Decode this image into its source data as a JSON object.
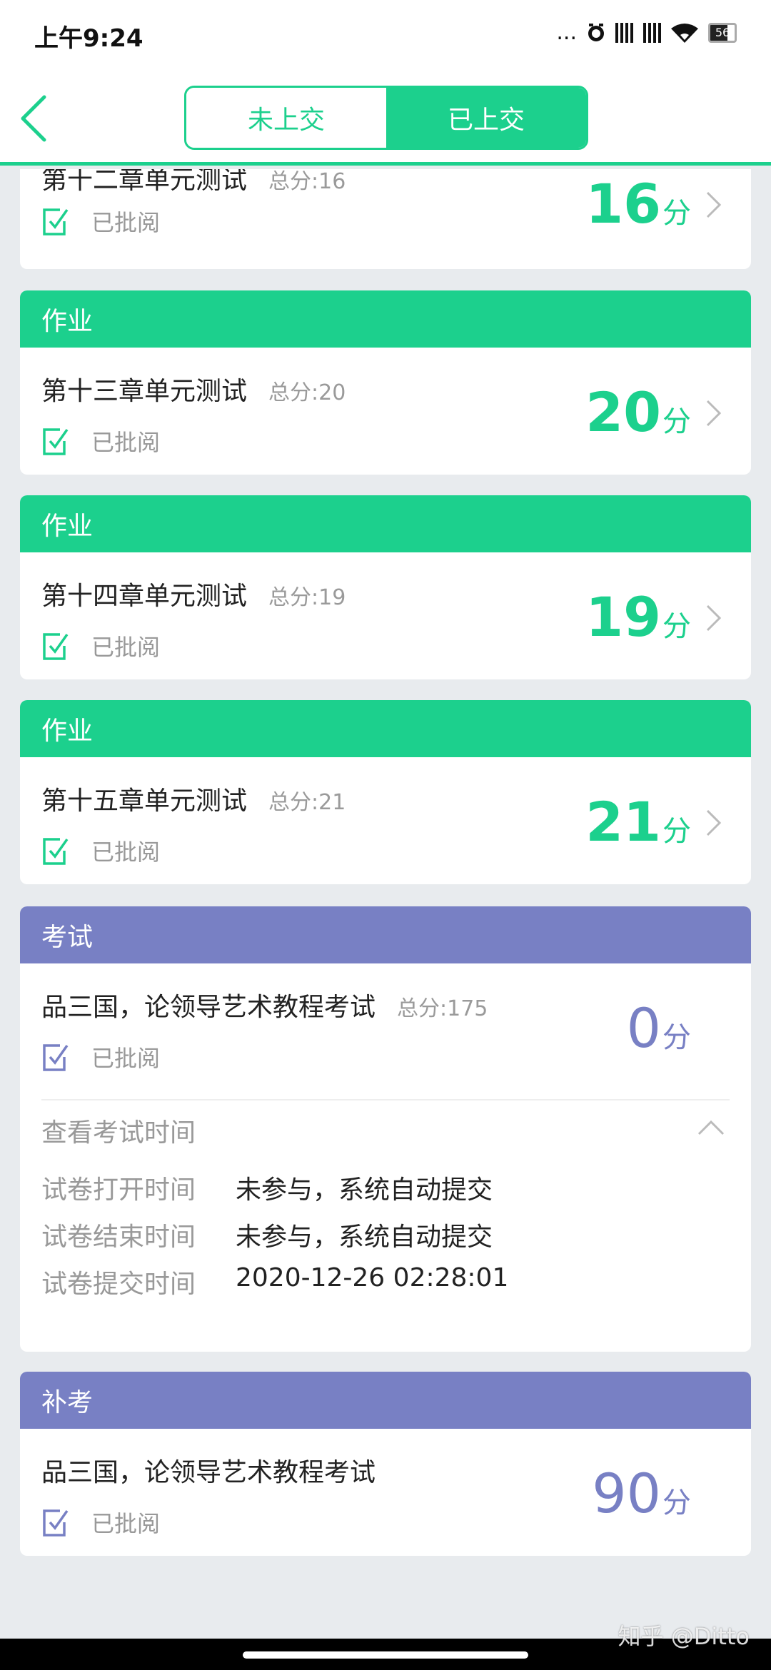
{
  "status_bar": {
    "time": "上午9:24",
    "dots": "...",
    "battery": "56"
  },
  "header": {
    "tabs": [
      {
        "label": "未上交",
        "active": false
      },
      {
        "label": "已上交",
        "active": true
      }
    ]
  },
  "cards": [
    {
      "title": "第十二章单元测试",
      "total": "总分:16",
      "status": "已批阅",
      "score": "16",
      "unit": "分"
    },
    {
      "type": "作业",
      "title": "第十三章单元测试",
      "total": "总分:20",
      "status": "已批阅",
      "score": "20",
      "unit": "分"
    },
    {
      "type": "作业",
      "title": "第十四章单元测试",
      "total": "总分:19",
      "status": "已批阅",
      "score": "19",
      "unit": "分"
    },
    {
      "type": "作业",
      "title": "第十五章单元测试",
      "total": "总分:21",
      "status": "已批阅",
      "score": "21",
      "unit": "分"
    },
    {
      "type": "考试",
      "title": "品三国，论领导艺术教程考试",
      "total": "总分:175",
      "status": "已批阅",
      "score": "0",
      "unit": "分",
      "details_toggle": "查看考试时间",
      "details": [
        {
          "label": "试卷打开时间",
          "value": "未参与，系统自动提交"
        },
        {
          "label": "试卷结束时间",
          "value": "未参与，系统自动提交"
        },
        {
          "label": "试卷提交时间",
          "value": "2020-12-26 02:28:01"
        }
      ]
    },
    {
      "type": "补考",
      "title": "品三国，论领导艺术教程考试",
      "status": "已批阅",
      "score": "90",
      "unit": "分"
    }
  ],
  "watermark": "知乎 @Ditto",
  "colors": {
    "accent_green": "#1cd08d",
    "accent_purple": "#7880c4",
    "background": "#e8ebee"
  }
}
